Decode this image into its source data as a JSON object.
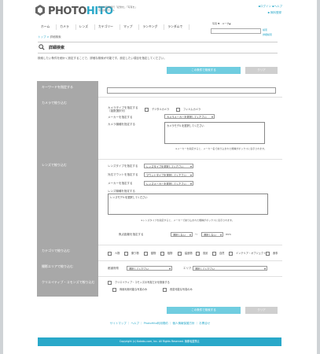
{
  "header": {
    "logo_text_a": "PHOTO",
    "logo_text_b": "HITO",
    "tagline_1": "日本の時間旅行「記憶を」「写真を」",
    "tagline_2": "写真共有サイト",
    "top_links": "▪ログイン ▪ヘルプ",
    "register_link": "▪ 無料登録",
    "nav": [
      "ホーム",
      "カメラ",
      "レンズ",
      "カテゴリー",
      "マップ",
      "ランキング",
      "ランダムで"
    ],
    "search_scope": "写真 ▼　ユーザー",
    "search_placeholder": "",
    "search_button": "検索",
    "advanced_link": "詳細検索"
  },
  "breadcrumb": {
    "home": "トップ",
    "current": "詳細検索"
  },
  "title": {
    "icon": "search-icon",
    "text": "詳細検索"
  },
  "intro": "検索したい条件を細かく設定することで、詳細な検索が可能です。設定したい項目を指定してください。",
  "buttons": {
    "search": "この条件で検索する",
    "clear": "クリア"
  },
  "keyword": {
    "label": "キーワードを指定する",
    "value": ""
  },
  "camera": {
    "label": "カメラで絞り込む",
    "type_label": "カメラタイプを指定する（複数選択可）",
    "type_options": [
      "デジタルカメラ",
      "フィルムカメラ"
    ],
    "maker_label": "メーカーを指定する",
    "maker_value": "カメラメーカーを選択してください",
    "model_label": "カメラ機種を指定する",
    "model_value": "カメラモデルを選択してください",
    "note": "※メーカーを指定すると、メーカー名で絞り込まれた機種がボックスに表示されます。"
  },
  "lens": {
    "label": "レンズで絞り込む",
    "type_label": "レンズタイプを指定する",
    "type_value": "レンズタイプを選択してください",
    "mount_label": "対応マウントを指定する",
    "mount_value": "マウントタイプを選択してください",
    "maker_label": "メーカーを指定する",
    "maker_value": "レンズメーカーを選択してください",
    "model_label": "レンズ機種を指定する",
    "model_value": "レンズモデルを選択してください",
    "note": "※レンズタイプを指定すると、メーカーで絞り込まれた機種がボックスに表示されます。",
    "focal_label": "焦点距離を指定する",
    "focal_from": "選択しない",
    "focal_to": "選択しない",
    "focal_unit": "mm"
  },
  "category": {
    "label": "カテゴリで絞り込む",
    "options": [
      "人物",
      "乗り物",
      "動物",
      "植物",
      "建造物",
      "風景",
      "自然",
      "インテリア・オブジェクト",
      "食事"
    ]
  },
  "area": {
    "label": "撮影エリアで絞り込む",
    "pref_label": "都道府県",
    "pref_value": "選択してください",
    "area_label": "エリア",
    "area_value": "選択してください"
  },
  "cc": {
    "label": "クリエイティブ・コモンズで絞り込む",
    "options": [
      "クリエイティブ・コモンズの写真だけを検索する",
      "商用利用可能な写真のみ",
      "改変可能な写真のみ"
    ]
  },
  "footer": {
    "links": "サイトマップ ｜ ヘルプ ｜ PhotoHito利用規約 ｜ 個人情報保護方針 ｜ お問合せ",
    "copyright": "Copyright (c) Kakaku.com, Inc. All Rights Reserved. 無断転載禁止"
  },
  "colors": {
    "accent": "#29a8c9",
    "button": "#70cde0",
    "label_bg": "#a8a8a8"
  }
}
